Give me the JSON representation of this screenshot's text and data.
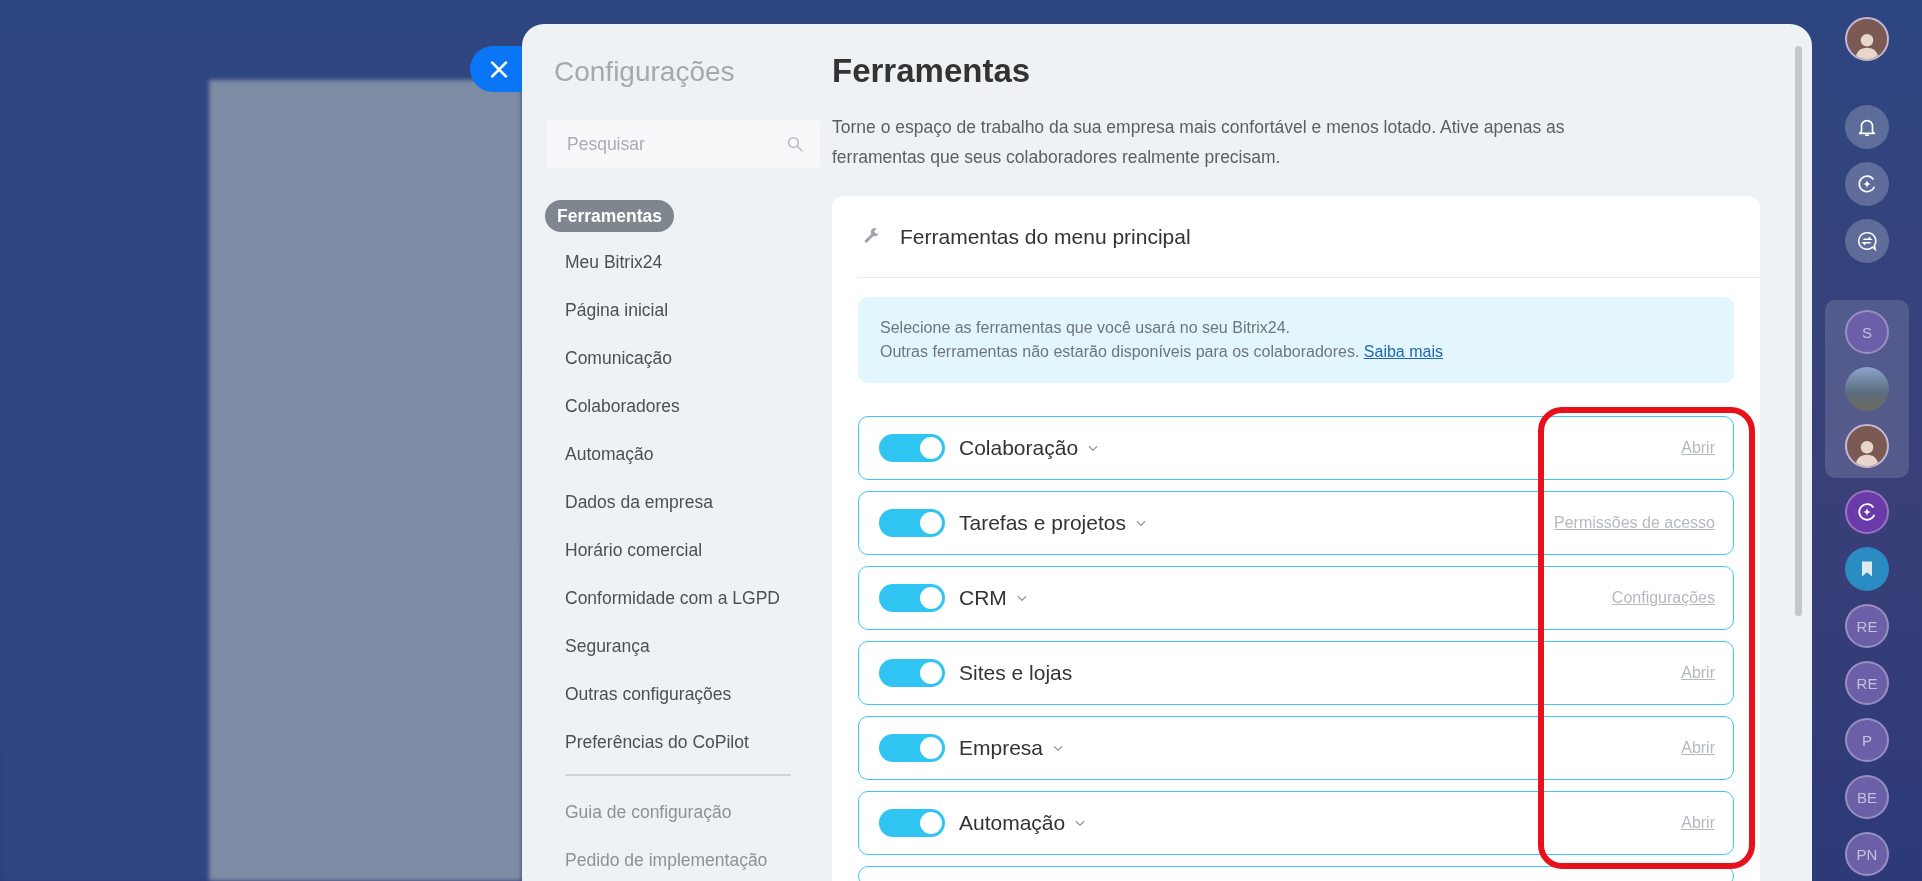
{
  "close_button": {
    "label": "×"
  },
  "sidebar": {
    "title": "Configurações",
    "search": {
      "placeholder": "Pesquisar"
    },
    "items": [
      {
        "label": "Ferramentas",
        "selected": true
      },
      {
        "label": "Meu Bitrix24",
        "selected": false
      },
      {
        "label": "Página inicial",
        "selected": false
      },
      {
        "label": "Comunicação",
        "selected": false
      },
      {
        "label": "Colaboradores",
        "selected": false
      },
      {
        "label": "Automação",
        "selected": false
      },
      {
        "label": "Dados da empresa",
        "selected": false
      },
      {
        "label": "Horário comercial",
        "selected": false
      },
      {
        "label": "Conformidade com a LGPD",
        "selected": false
      },
      {
        "label": "Segurança",
        "selected": false
      },
      {
        "label": "Outras configurações",
        "selected": false
      },
      {
        "label": "Preferências do CoPilot",
        "selected": false
      }
    ],
    "secondary_items": [
      {
        "label": "Guia de configuração"
      },
      {
        "label": "Pedido de implementação"
      }
    ]
  },
  "page": {
    "title": "Ferramentas",
    "description": "Torne o espaço de trabalho da sua empresa mais confortável e menos lotado. Ative apenas as ferramentas que seus colaboradores realmente precisam.",
    "section": {
      "title": "Ferramentas do menu principal",
      "info": {
        "lines": [
          "Selecione as ferramentas que você usará no seu Bitrix24.",
          "Outras ferramentas não estarão disponíveis para os colaboradores."
        ],
        "link": "Saiba mais"
      },
      "tools": [
        {
          "name": "Colaboração",
          "on": true,
          "expandable": true,
          "action": "Abrir"
        },
        {
          "name": "Tarefas e projetos",
          "on": true,
          "expandable": true,
          "action": "Permissões de acesso"
        },
        {
          "name": "CRM",
          "on": true,
          "expandable": true,
          "action": "Configurações"
        },
        {
          "name": "Sites e lojas",
          "on": true,
          "expandable": false,
          "action": "Abrir"
        },
        {
          "name": "Empresa",
          "on": true,
          "expandable": true,
          "action": "Abrir"
        },
        {
          "name": "Automação",
          "on": true,
          "expandable": true,
          "action": "Abrir"
        }
      ]
    }
  },
  "right_bar": {
    "items": [
      {
        "kind": "avatar"
      },
      {
        "kind": "bell"
      },
      {
        "kind": "copilot"
      },
      {
        "kind": "chat"
      },
      {
        "kind": "divider"
      },
      {
        "kind": "group",
        "children": [
          {
            "kind": "letter",
            "text": "S"
          },
          {
            "kind": "landscape"
          },
          {
            "kind": "avatar"
          }
        ]
      },
      {
        "kind": "copilot-app"
      },
      {
        "kind": "bookmark"
      },
      {
        "kind": "letter",
        "text": "RE"
      },
      {
        "kind": "letter",
        "text": "RE"
      },
      {
        "kind": "letter",
        "text": "P"
      },
      {
        "kind": "letter",
        "text": "BE"
      },
      {
        "kind": "letter",
        "text": "PN"
      }
    ]
  }
}
